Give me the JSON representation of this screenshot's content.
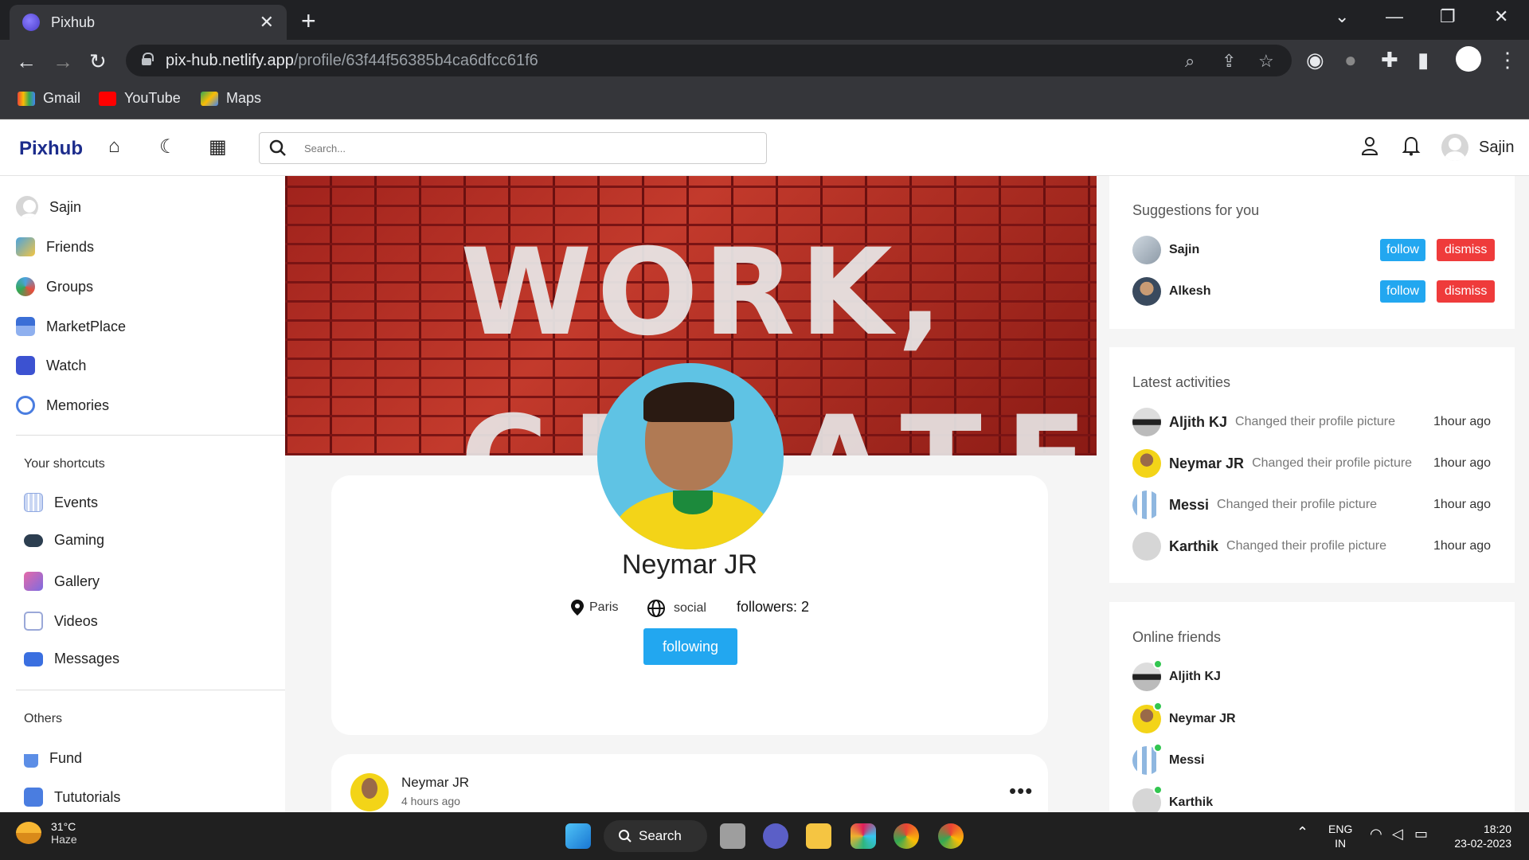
{
  "browser": {
    "tab_title": "Pixhub",
    "url_host": "pix-hub.netlify.app",
    "url_path": "/profile/63f44f56385b4ca6dfcc61f6",
    "bookmarks": [
      "Gmail",
      "YouTube",
      "Maps"
    ]
  },
  "header": {
    "logo": "Pixhub",
    "search_placeholder": "Search...",
    "username": "Sajin"
  },
  "sidebar": {
    "user": "Sajin",
    "items": [
      "Friends",
      "Groups",
      "MarketPlace",
      "Watch",
      "Memories"
    ],
    "shortcuts_title": "Your shortcuts",
    "shortcuts": [
      "Events",
      "Gaming",
      "Gallery",
      "Videos",
      "Messages"
    ],
    "others_title": "Others",
    "others": [
      "Fund",
      "Tututorials"
    ]
  },
  "profile": {
    "name": "Neymar JR",
    "city": "Paris",
    "site": "social",
    "followers": "followers: 2",
    "follow_button": "following"
  },
  "post": {
    "author": "Neymar JR",
    "time": "4 hours ago"
  },
  "suggestions": {
    "title": "Suggestions for you",
    "people": [
      {
        "name": "Sajin",
        "follow": "follow",
        "dismiss": "dismiss"
      },
      {
        "name": "Alkesh",
        "follow": "follow",
        "dismiss": "dismiss"
      }
    ]
  },
  "activities": {
    "title": "Latest activities",
    "items": [
      {
        "name": "Aljith KJ",
        "action": "Changed their profile picture",
        "time": "1hour ago"
      },
      {
        "name": "Neymar JR",
        "action": "Changed their profile picture",
        "time": "1hour ago"
      },
      {
        "name": "Messi",
        "action": "Changed their profile picture",
        "time": "1hour ago"
      },
      {
        "name": "Karthik",
        "action": "Changed their profile picture",
        "time": "1hour ago"
      }
    ]
  },
  "online": {
    "title": "Online friends",
    "friends": [
      "Aljith KJ",
      "Neymar JR",
      "Messi",
      "Karthik"
    ]
  },
  "taskbar": {
    "temp": "31°C",
    "weather": "Haze",
    "search": "Search",
    "lang1": "ENG",
    "lang2": "IN",
    "time": "18:20",
    "date": "23-02-2023"
  },
  "colors": {
    "accent": "#22a7f0",
    "dismiss": "#ef3b3b",
    "logo": "#1c2c8c",
    "online": "#32c650"
  }
}
